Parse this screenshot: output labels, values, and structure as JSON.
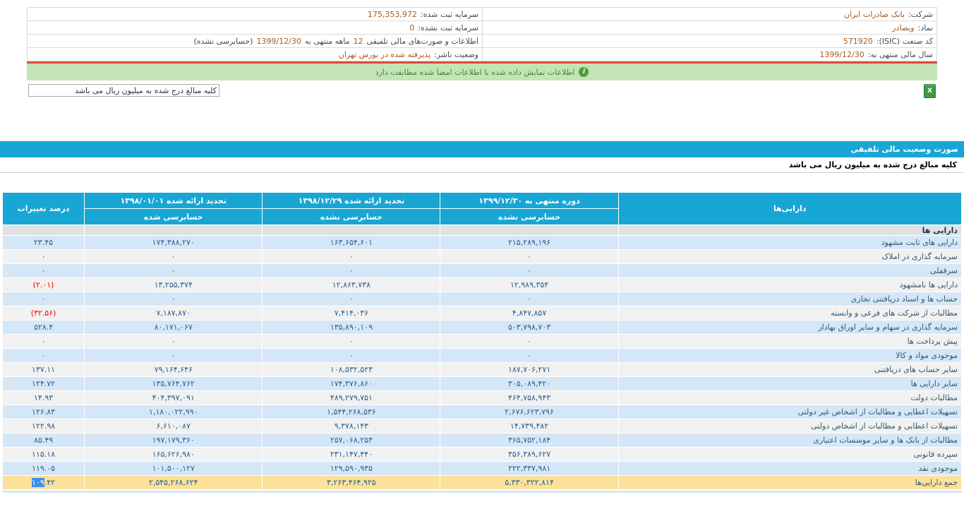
{
  "colors": {
    "accent_cyan": "#18a6d4",
    "banner_green_bg": "#c4e4b6",
    "banner_green_text": "#3a8a2e",
    "alert_red": "#dd4a3d",
    "row_blue": "#d5e7f7",
    "row_gray": "#f1f1f1",
    "row_section": "#e1e1e1",
    "row_total_yellow": "#fbe199",
    "value_blue": "#2b5f8c",
    "label_color": "#33596e",
    "negative_red": "#ff0000",
    "info_value_rust": "#a85719",
    "selection_blue": "#3a8ff0"
  },
  "icons": {
    "info": "i",
    "excel": "X"
  },
  "company_info": {
    "company_label": "شرکت:",
    "company_value": "بانک صادرات ایران",
    "registered_capital_label": "سرمایه ثبت شده:",
    "registered_capital_value": "175,353,972",
    "symbol_label": "نماد:",
    "symbol_value": "وبصادر",
    "unregistered_capital_label": "سرمایه ثبت نشده:",
    "unregistered_capital_value": "0",
    "isic_label": "کد صنعت (ISIC):",
    "isic_value": "571920",
    "statement_prefix": "اطلاعات و صورت‌های مالی تلفیقی ",
    "statement_months": "12",
    "statement_mid": " ماهه منتهی به ",
    "statement_date": "1399/12/30",
    "statement_suffix": " (حسابرسی نشده)",
    "fiscal_year_label": "سال مالی منتهی به:",
    "fiscal_year_value": "1399/12/30",
    "publisher_status_label": "وضعیت ناشر:",
    "publisher_status_value": "پذیرفته شده در بورس تهران"
  },
  "banner": {
    "text": "اطلاعات نمایش داده شده با اطلاعات امضا شده مطابقت دارد"
  },
  "controls": {
    "unit_note": "کلیه مبالغ درج شده به میلیون ریال می باشد"
  },
  "section": {
    "title": "صورت وضعیت مالی تلفیقی",
    "unit_note": "کلیه مبالغ درج شده به میلیون ریال می باشد"
  },
  "table": {
    "assets_header": "دارایی‌ها",
    "pct_header": "درصد تغییرات",
    "columns": [
      {
        "title": "دوره منتهی به ۱۳۹۹/۱۲/۳۰",
        "sub": "حسابرسی نشده"
      },
      {
        "title": "تجدید ارائه شده ۱۳۹۸/۱۲/۲۹",
        "sub": "حسابرسی نشده"
      },
      {
        "title": "تجدید ارائه شده ۱۳۹۸/۰۱/۰۱",
        "sub": "حسابرسی شده"
      }
    ],
    "rows": [
      {
        "type": "section",
        "label": "دارایی ها",
        "v1": "",
        "v2": "",
        "v3": "",
        "pct": ""
      },
      {
        "type": "data",
        "label": "دارایی های ثابت مشهود",
        "v1": "۲۱۵,۲۸۹,۱۹۶",
        "v2": "۱۶۳,۶۵۴,۶۰۱",
        "v3": "۱۷۴,۳۸۸,۲۷۰",
        "pct": "۲۳.۴۵",
        "neg": false
      },
      {
        "type": "data",
        "label": "سرمایه گذاری در املاک",
        "v1": "۰",
        "v2": "۰",
        "v3": "۰",
        "pct": "۰",
        "neg": false
      },
      {
        "type": "data",
        "label": "سرقفلی",
        "v1": "۰",
        "v2": "۰",
        "v3": "۰",
        "pct": "۰",
        "neg": false
      },
      {
        "type": "data",
        "label": "دارایی ها نامشهود",
        "v1": "۱۲,۹۸۹,۳۵۴",
        "v2": "۱۲,۸۶۳,۷۳۸",
        "v3": "۱۳,۲۵۵,۳۷۴",
        "pct": "(۲.۰۱)",
        "neg": true
      },
      {
        "type": "data",
        "label": "حساب ها و اسناد دریافتنی تجاری",
        "v1": "۰",
        "v2": "۰",
        "v3": "۰",
        "pct": "۰",
        "neg": false
      },
      {
        "type": "data",
        "label": "مطالبات از شرکت های فرعی و وابسته",
        "v1": "۴,۸۴۷,۸۵۷",
        "v2": "۷,۴۱۴,۰۳۶",
        "v3": "۷,۱۸۷,۸۷۰",
        "pct": "(۳۲.۵۶)",
        "neg": true
      },
      {
        "type": "data",
        "label": "سرمایه گذاری در سهام و سایر اوراق بهادار",
        "v1": "۵۰۳,۷۹۸,۷۰۳",
        "v2": "۱۳۵,۸۹۰,۱۰۹",
        "v3": "۸۰,۱۷۱,۰۶۷",
        "pct": "۵۲۸.۴",
        "neg": false
      },
      {
        "type": "data",
        "label": "پیش پرداخت ها",
        "v1": "۰",
        "v2": "۰",
        "v3": "۰",
        "pct": "۰",
        "neg": false
      },
      {
        "type": "data",
        "label": "موجودی مواد و کالا",
        "v1": "۰",
        "v2": "۰",
        "v3": "۰",
        "pct": "۰",
        "neg": false
      },
      {
        "type": "data",
        "label": "سایر حساب های دریافتنی",
        "v1": "۱۸۷,۷۰۶,۲۷۱",
        "v2": "۱۰۸,۵۳۲,۵۲۳",
        "v3": "۷۹,۱۶۴,۶۴۶",
        "pct": "۱۳۷.۱۱",
        "neg": false
      },
      {
        "type": "data",
        "label": "سایر دارایی ها",
        "v1": "۳۰۵,۰۸۹,۴۲۰",
        "v2": "۱۷۴,۳۷۶,۸۶۰",
        "v3": "۱۳۵,۷۶۴,۷۶۲",
        "pct": "۱۲۴.۷۲",
        "neg": false
      },
      {
        "type": "data",
        "label": "مطالبات دولت",
        "v1": "۴۶۴,۷۵۸,۹۴۳",
        "v2": "۴۸۹,۲۷۹,۷۵۱",
        "v3": "۴۰۴,۳۹۷,۰۹۱",
        "pct": "۱۴.۹۳",
        "neg": false
      },
      {
        "type": "data",
        "label": "تسهیلات اعطایی و مطالبات از اشخاص غیر دولتی",
        "v1": "۲,۶۷۶,۶۲۳,۷۹۶",
        "v2": "۱,۵۴۴,۲۶۸,۵۳۶",
        "v3": "۱,۱۸۰,۰۲۲,۹۹۰",
        "pct": "۱۲۶.۸۳",
        "neg": false
      },
      {
        "type": "data",
        "label": "تسهیلات اعطایی و مطالبات از اشخاص دولتی",
        "v1": "۱۴,۷۳۹,۴۸۲",
        "v2": "۹,۳۷۸,۱۴۳",
        "v3": "۶,۶۱۰,۰۸۷",
        "pct": "۱۲۲.۹۸",
        "neg": false
      },
      {
        "type": "data",
        "label": "مطالبات از بانک ها و سایر موسسات اعتباری",
        "v1": "۳۶۵,۷۵۲,۱۸۴",
        "v2": "۲۵۷,۰۶۸,۲۵۳",
        "v3": "۱۹۷,۱۷۹,۳۶۰",
        "pct": "۸۵.۴۹",
        "neg": false
      },
      {
        "type": "data",
        "label": "سپرده قانونی",
        "v1": "۳۵۶,۳۸۹,۶۲۷",
        "v2": "۲۳۱,۱۴۷,۴۴۰",
        "v3": "۱۶۵,۶۲۶,۹۸۰",
        "pct": "۱۱۵.۱۸",
        "neg": false
      },
      {
        "type": "data",
        "label": "موجودی نقد",
        "v1": "۲۲۲,۳۳۷,۹۸۱",
        "v2": "۱۲۹,۵۹۰,۹۳۵",
        "v3": "۱۰۱,۵۰۰,۱۲۷",
        "pct": "۱۱۹.۰۵",
        "neg": false
      },
      {
        "type": "total",
        "label": "جمع دارایی‌ها",
        "v1": "۵,۳۳۰,۳۲۲,۸۱۴",
        "v2": "۳,۲۶۳,۴۶۴,۹۲۵",
        "v3": "۲,۵۴۵,۲۶۸,۶۲۴",
        "pct_selected": "۱۰۹",
        "pct_rest": ".۴۲"
      }
    ]
  }
}
